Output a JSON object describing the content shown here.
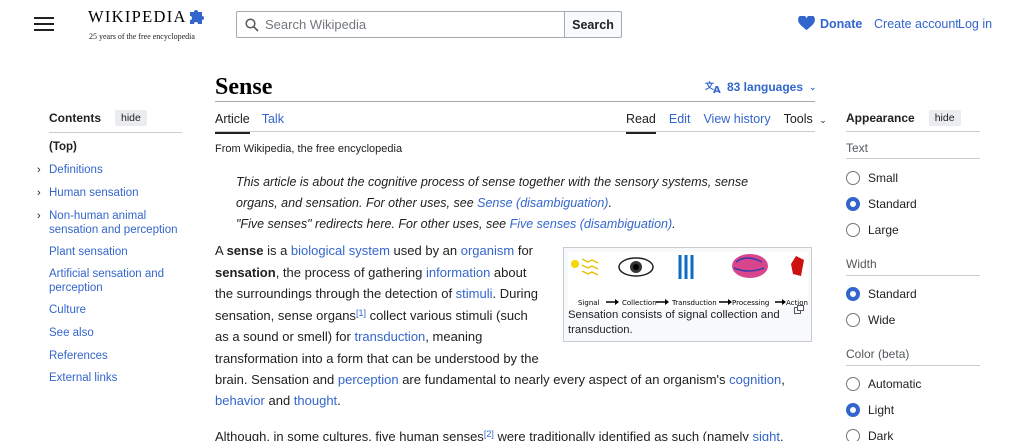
{
  "header": {
    "logo_word": "WIKIPEDIA",
    "logo_tagline": "25 years of the free encyclopedia",
    "search_placeholder": "Search Wikipedia",
    "search_button": "Search",
    "donate": "Donate",
    "create_account": "Create account",
    "login": "Log in"
  },
  "page": {
    "title": "Sense",
    "languages": "83 languages",
    "tabs_left": [
      "Article",
      "Talk"
    ],
    "tabs_right": [
      "Read",
      "Edit",
      "View history",
      "Tools"
    ],
    "from": "From Wikipedia, the free encyclopedia"
  },
  "toc": {
    "title": "Contents",
    "hide": "hide",
    "items": [
      "(Top)",
      "Definitions",
      "Human sensation",
      "Non-human animal sensation and perception",
      "Plant sensation",
      "Artificial sensation and perception",
      "Culture",
      "See also",
      "References",
      "External links"
    ]
  },
  "appearance": {
    "title": "Appearance",
    "hide": "hide",
    "text_label": "Text",
    "text_options": [
      "Small",
      "Standard",
      "Large"
    ],
    "text_selected": "Standard",
    "width_label": "Width",
    "width_options": [
      "Standard",
      "Wide"
    ],
    "width_selected": "Standard",
    "color_label": "Color (beta)",
    "color_options": [
      "Automatic",
      "Light",
      "Dark"
    ],
    "color_selected": "Light"
  },
  "hatnotes": {
    "line1": "This article is about the cognitive process of sense together with the sensory systems, sense",
    "line2a": "organs, and sensation. For other uses, see ",
    "line2_link": "Sense (disambiguation)",
    "line2b": ".",
    "line3a": "\"Five senses\" redirects here. For other uses, see ",
    "line3_link": "Five senses (disambiguation)",
    "line3b": "."
  },
  "figure": {
    "labels": [
      "Signal",
      "Collection",
      "Transduction",
      "Processing",
      "Action"
    ],
    "caption": "Sensation consists of signal collection and transduction."
  },
  "article": {
    "p1": {
      "t0": "A ",
      "b0": "sense",
      "t1": " is a ",
      "l0": "biological system",
      "t2": " used by an ",
      "l1": "organism",
      "t3": " for",
      "b1": "sensation",
      "t4": ", the process of gathering ",
      "l2": "information",
      "t5": " about",
      "t6": "the surroundings through the detection of ",
      "l3": "stimuli",
      "t7": ". During",
      "t8": "sensation, sense organs",
      "s0": "[1]",
      "t9": " collect various stimuli (such",
      "t10": "as a sound or smell) for ",
      "l4": "transduction",
      "t11": ", meaning",
      "t12": "transformation into a form that can be understood by the",
      "t13": "brain. Sensation and ",
      "l5": "perception",
      "t14": " are fundamental to nearly every aspect of an organism's ",
      "l6": "cognition",
      "t15": ",",
      "l7": "behavior",
      "t16": " and ",
      "l8": "thought",
      "t17": "."
    },
    "p2": {
      "t0": "Although, in some cultures, five human senses",
      "s0": "[2]",
      "t1": " were traditionally identified as such (namely ",
      "l0": "sight",
      "t2": ","
    }
  }
}
